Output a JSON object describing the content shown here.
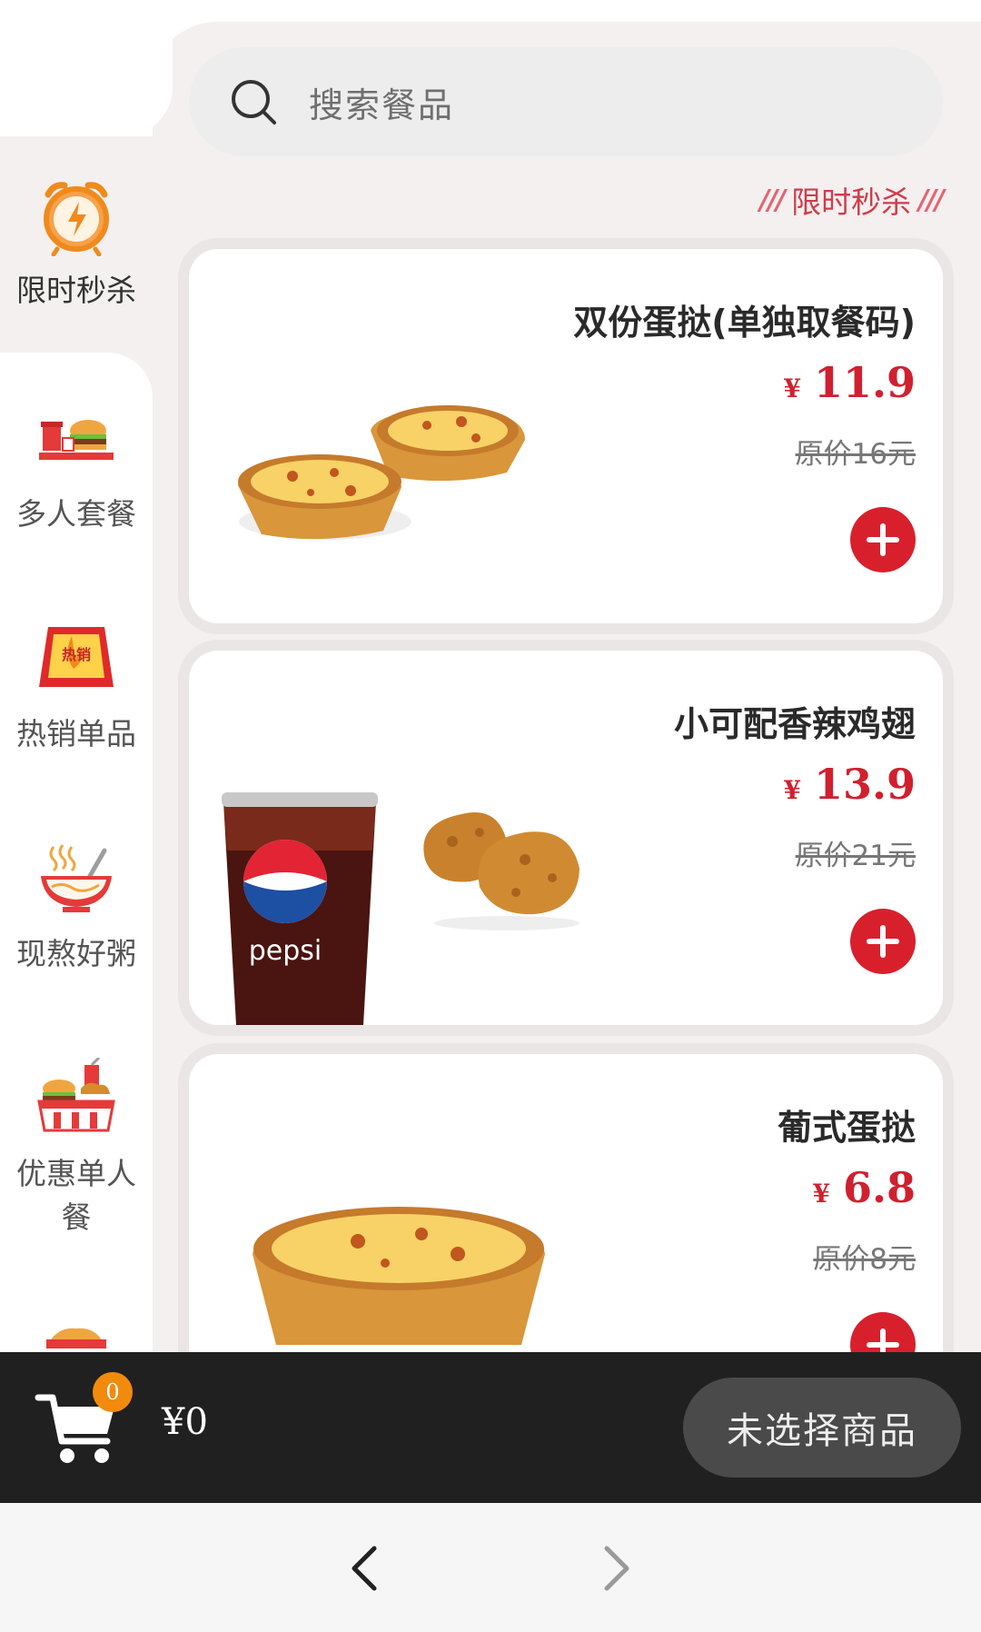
{
  "search": {
    "placeholder": "搜索餐品",
    "icon": "search-icon"
  },
  "sidebar": {
    "items": [
      {
        "label": "限时秒杀",
        "icon": "alarm-clock-icon",
        "active": true
      },
      {
        "label": "多人套餐",
        "icon": "combo-meal-icon",
        "active": false
      },
      {
        "label": "热销单品",
        "icon": "hot-sale-icon",
        "active": false
      },
      {
        "label": "现熬好粥",
        "icon": "porridge-bowl-icon",
        "active": false
      },
      {
        "label": "优惠单人餐",
        "icon": "single-meal-icon",
        "active": false
      }
    ]
  },
  "section": {
    "title": "限时秒杀",
    "decor_left": "///",
    "decor_right": "///"
  },
  "products": [
    {
      "name": "双份蛋挞(单独取餐码)",
      "currency": "¥",
      "price": "11.9",
      "original": "原价16元",
      "image": "two-egg-tarts"
    },
    {
      "name": "小可配香辣鸡翅",
      "currency": "¥",
      "price": "13.9",
      "original": "原价21元",
      "image": "pepsi-and-wings",
      "brand_text": "pepsi"
    },
    {
      "name": "葡式蛋挞",
      "currency": "¥",
      "price": "6.8",
      "original": "原价8元",
      "image": "single-egg-tart"
    }
  ],
  "cart": {
    "count": "0",
    "total": "¥0",
    "checkout_label": "未选择商品"
  },
  "nav": {
    "back": "back-arrow-icon",
    "forward": "forward-arrow-icon"
  },
  "colors": {
    "accent": "#d8202d",
    "orange": "#f28a0e",
    "dark_bar": "#202020",
    "bg": "#f4f0f0"
  }
}
